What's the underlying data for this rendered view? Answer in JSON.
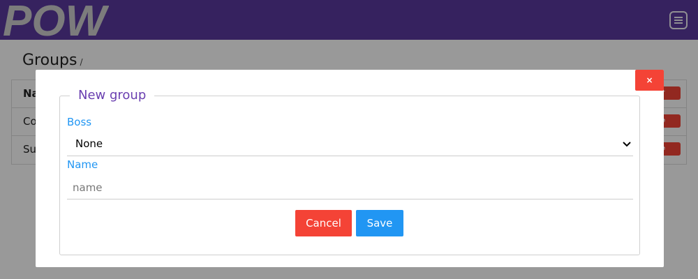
{
  "header": {
    "logo_text": "POW",
    "menu_icon": "hamburger-menu-icon",
    "bg_color": "#5a3a9e"
  },
  "page": {
    "title": "Groups",
    "breadcrumb_sep": "/"
  },
  "table": {
    "header": {
      "cell": "Na",
      "button": "ter"
    },
    "rows": [
      {
        "cell": "Co",
        "button": "ete"
      },
      {
        "cell": "Su",
        "button": "ete"
      }
    ]
  },
  "modal": {
    "close_label": "×",
    "legend": "New group",
    "boss_label": "Boss",
    "boss_value": "None",
    "name_label": "Name",
    "name_placeholder": "name",
    "name_value": "",
    "cancel_label": "Cancel",
    "save_label": "Save",
    "colors": {
      "danger": "#f44336",
      "primary": "#2196f3",
      "legend": "#6a3fb0"
    }
  }
}
